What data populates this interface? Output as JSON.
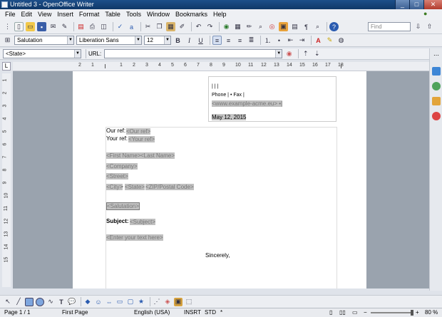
{
  "window": {
    "title": "Untitled 3 - OpenOffice Writer",
    "min": "_",
    "max": "□",
    "close": "✕"
  },
  "menu": [
    "File",
    "Edit",
    "View",
    "Insert",
    "Format",
    "Table",
    "Tools",
    "Window",
    "Bookmarks",
    "Help"
  ],
  "toolbar": {
    "find_placeholder": "Find",
    "style": "Salutation",
    "font": "Liberation Sans",
    "size": "12",
    "bold": "B",
    "italic": "I",
    "underline": "U"
  },
  "navbar": {
    "state_value": "<State>",
    "url_label": "URL:"
  },
  "ruler": {
    "numbers": [
      "2",
      "1",
      "1",
      "2",
      "3",
      "4",
      "5",
      "6",
      "7",
      "8",
      "9",
      "10",
      "11",
      "12",
      "13",
      "14",
      "15",
      "16",
      "17",
      "18"
    ]
  },
  "vruler": {
    "numbers": [
      "1",
      "2",
      "3",
      "4",
      "5",
      "6",
      "7",
      "8",
      "9",
      "10",
      "11",
      "12",
      "13",
      "14",
      "15"
    ]
  },
  "document": {
    "header_line1": "| | |",
    "phone_fax": "Phone | • Fax |",
    "website": "<www.example-acme.eu> •|",
    "date": "May 12, 2015",
    "our_ref_label": "Our ref:",
    "our_ref_field": "<Our ref>",
    "your_ref_label": "Your ref:",
    "your_ref_field": "<Your ref>",
    "first_name": "<First Name>",
    "last_name": "<Last Name>",
    "company": "<Company>",
    "street": "<Street>",
    "city": "<City>",
    "comma": ",",
    "state": "<State>",
    "zip": "<ZIP/Postal Code>",
    "salutation": "<Salutation>",
    "subject_label": "Subject:",
    "subject_field": "<Subject>",
    "body_field": "<Enter your text here>",
    "closing": "Sincerely,"
  },
  "status": {
    "page": "Page 1 / 1",
    "page_style": "First Page",
    "language": "English (USA)",
    "mode": "INSRT",
    "selection": "STD",
    "asterisk": "*",
    "zoom": "80 %"
  }
}
